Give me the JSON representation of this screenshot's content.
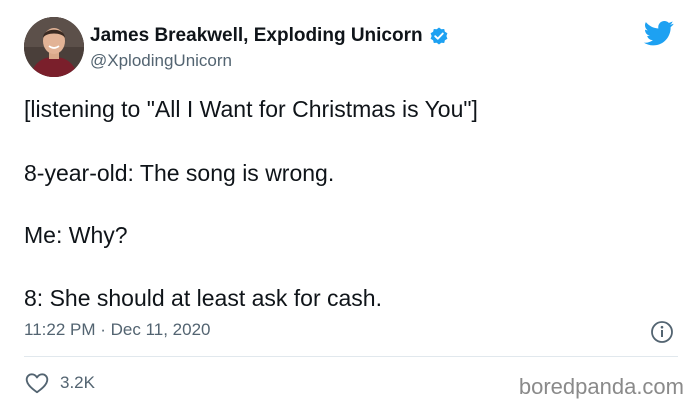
{
  "user": {
    "display_name": "James Breakwell, Exploding Unicorn",
    "handle": "@XplodingUnicorn",
    "verified": true,
    "avatar_icon": "profile-photo"
  },
  "tweet": {
    "lines": [
      "[listening to \"All I Want for Christmas is You\"]",
      "8-year-old: The song is wrong.",
      "Me: Why?",
      "8: She should at least ask for cash."
    ],
    "timestamp": "11:22 PM · Dec 11, 2020",
    "likes": "3.2K"
  },
  "icons": {
    "brand": "twitter-bird-icon",
    "verified": "verified-badge-icon",
    "info": "info-icon",
    "like": "heart-icon"
  },
  "colors": {
    "brand_blue": "#1da1f2",
    "text": "#0f1419",
    "muted": "#536471",
    "watermark": "#8a8a8a"
  },
  "watermark": "boredpanda.com"
}
